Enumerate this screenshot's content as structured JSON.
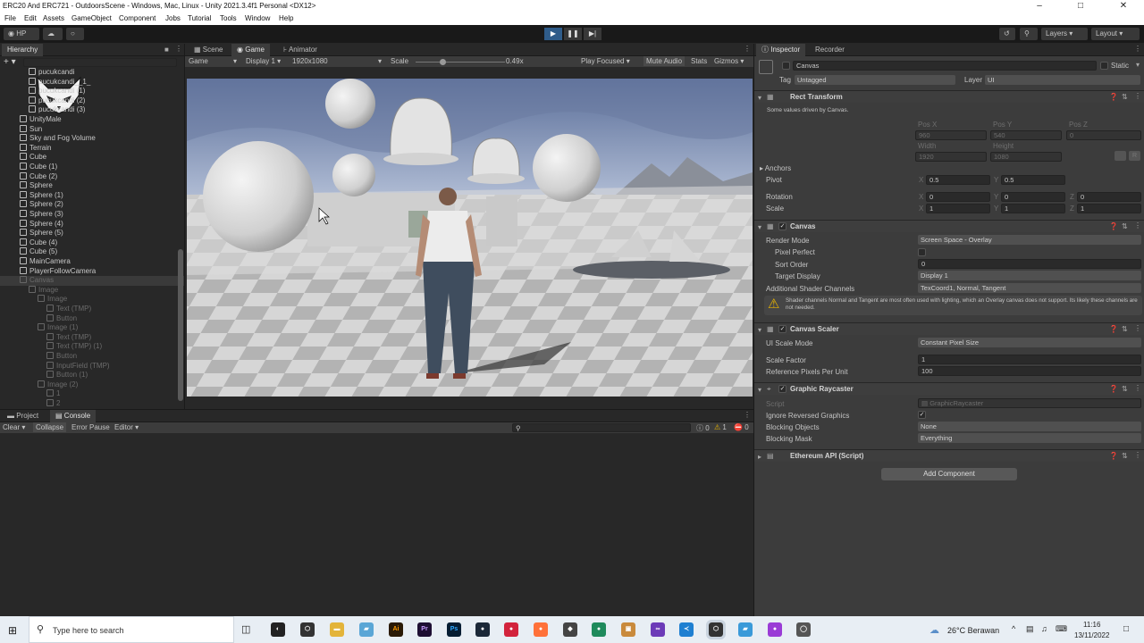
{
  "window": {
    "title": "ERC20 And ERC721 - OutdoorsScene - Windows, Mac, Linux - Unity 2021.3.4f1 Personal <DX12>"
  },
  "menu": [
    "File",
    "Edit",
    "Assets",
    "GameObject",
    "Component",
    "Jobs",
    "Tutorial",
    "Tools",
    "Window",
    "Help"
  ],
  "toolbar": {
    "account": "HP",
    "layers": "Layers",
    "layout": "Layout"
  },
  "hierarchy": {
    "tab": "Hierarchy",
    "rows": [
      {
        "label": "pucukcandi",
        "indent": 2,
        "dim": false
      },
      {
        "label": "pucukcandi__1_",
        "indent": 2,
        "dim": false
      },
      {
        "label": "pucukcandi (1)",
        "indent": 2,
        "dim": false
      },
      {
        "label": "pucukcandi (2)",
        "indent": 2,
        "dim": false
      },
      {
        "label": "pucukcandi (3)",
        "indent": 2,
        "dim": false
      },
      {
        "label": "UnityMale",
        "indent": 1,
        "dim": false
      },
      {
        "label": "Sun",
        "indent": 1,
        "dim": false
      },
      {
        "label": "Sky and Fog Volume",
        "indent": 1,
        "dim": false
      },
      {
        "label": "Terrain",
        "indent": 1,
        "dim": false
      },
      {
        "label": "Cube",
        "indent": 1,
        "dim": false
      },
      {
        "label": "Cube (1)",
        "indent": 1,
        "dim": false
      },
      {
        "label": "Cube (2)",
        "indent": 1,
        "dim": false
      },
      {
        "label": "Sphere",
        "indent": 1,
        "dim": false
      },
      {
        "label": "Sphere (1)",
        "indent": 1,
        "dim": false
      },
      {
        "label": "Sphere (2)",
        "indent": 1,
        "dim": false
      },
      {
        "label": "Sphere (3)",
        "indent": 1,
        "dim": false
      },
      {
        "label": "Sphere (4)",
        "indent": 1,
        "dim": false
      },
      {
        "label": "Sphere (5)",
        "indent": 1,
        "dim": false
      },
      {
        "label": "Cube (4)",
        "indent": 1,
        "dim": false
      },
      {
        "label": "Cube (5)",
        "indent": 1,
        "dim": false
      },
      {
        "label": "MainCamera",
        "indent": 1,
        "dim": false
      },
      {
        "label": "PlayerFollowCamera",
        "indent": 1,
        "dim": false
      },
      {
        "label": "Canvas",
        "indent": 1,
        "dim": true,
        "selected": true
      },
      {
        "label": "Image",
        "indent": 2,
        "dim": true
      },
      {
        "label": "Image",
        "indent": 3,
        "dim": true
      },
      {
        "label": "Text (TMP)",
        "indent": 4,
        "dim": true
      },
      {
        "label": "Button",
        "indent": 4,
        "dim": true
      },
      {
        "label": "Image (1)",
        "indent": 3,
        "dim": true
      },
      {
        "label": "Text (TMP)",
        "indent": 4,
        "dim": true
      },
      {
        "label": "Text (TMP) (1)",
        "indent": 4,
        "dim": true
      },
      {
        "label": "Button",
        "indent": 4,
        "dim": true
      },
      {
        "label": "InputField (TMP)",
        "indent": 4,
        "dim": true
      },
      {
        "label": "Button (1)",
        "indent": 4,
        "dim": true
      },
      {
        "label": "Image (2)",
        "indent": 3,
        "dim": true
      },
      {
        "label": "1",
        "indent": 4,
        "dim": true
      },
      {
        "label": "2",
        "indent": 4,
        "dim": true
      }
    ]
  },
  "game": {
    "tabs": [
      "Scene",
      "Game",
      "Animator"
    ],
    "active_tab": "Game",
    "mode": "Game",
    "display": "Display 1",
    "resolution": "1920x1080",
    "scale_label": "Scale",
    "scale_value": "0.49x",
    "scale_fraction": 0.3,
    "play_focused": "Play Focused",
    "mute": "Mute Audio",
    "stats": "Stats",
    "gizmos": "Gizmos"
  },
  "console": {
    "tabs": [
      "Project",
      "Console"
    ],
    "active_tab": "Console",
    "clear": "Clear",
    "collapse": "Collapse",
    "error_pause": "Error Pause",
    "editor": "Editor",
    "counts": [
      "0",
      "1",
      "0"
    ]
  },
  "inspector": {
    "tabs": [
      "Inspector",
      "Recorder"
    ],
    "object_name": "Canvas",
    "static": "Static",
    "tag_label": "Tag",
    "tag_value": "Untagged",
    "layer_label": "Layer",
    "layer_value": "UI",
    "rect_transform": {
      "title": "Rect Transform",
      "note": "Some values driven by Canvas.",
      "pos_labels": [
        "Pos X",
        "Pos Y",
        "Pos Z"
      ],
      "pos_values": [
        "960",
        "540",
        "0"
      ],
      "size_labels": [
        "Width",
        "Height"
      ],
      "size_values": [
        "1920",
        "1080"
      ],
      "anchors": "Anchors",
      "pivot": "Pivot",
      "pivot_x": "0.5",
      "pivot_y": "0.5",
      "rotation": "Rotation",
      "rot": [
        "0",
        "0",
        "0"
      ],
      "scale": "Scale",
      "scl": [
        "1",
        "1",
        "1"
      ],
      "xyz": [
        "X",
        "Y",
        "Z"
      ],
      "r_button": "R"
    },
    "canvas": {
      "title": "Canvas",
      "render_mode_label": "Render Mode",
      "render_mode": "Screen Space - Overlay",
      "pixel_perfect": "Pixel Perfect",
      "sort_order_label": "Sort Order",
      "sort_order": "0",
      "target_display_label": "Target Display",
      "target_display": "Display 1",
      "shader_label": "Additional Shader Channels",
      "shader_value": "TexCoord1, Normal, Tangent",
      "warning": "Shader channels Normal and Tangent are most often used with lighting, which an Overlay canvas does not support. Its likely these channels are not needed."
    },
    "scaler": {
      "title": "Canvas Scaler",
      "mode_label": "UI Scale Mode",
      "mode": "Constant Pixel Size",
      "factor_label": "Scale Factor",
      "factor": "1",
      "ppu_label": "Reference Pixels Per Unit",
      "ppu": "100"
    },
    "raycaster": {
      "title": "Graphic Raycaster",
      "script_label": "Script",
      "script": "GraphicRaycaster",
      "ignore_label": "Ignore Reversed Graphics",
      "blocking_objects_label": "Blocking Objects",
      "blocking_objects": "None",
      "blocking_mask_label": "Blocking Mask",
      "blocking_mask": "Everything"
    },
    "ethereum": {
      "title": "Ethereum API (Script)"
    },
    "add_component": "Add Component"
  },
  "taskbar": {
    "search": "Type here to search",
    "weather": "26°C  Berawan",
    "time": "11:16",
    "date": "13/11/2022"
  }
}
